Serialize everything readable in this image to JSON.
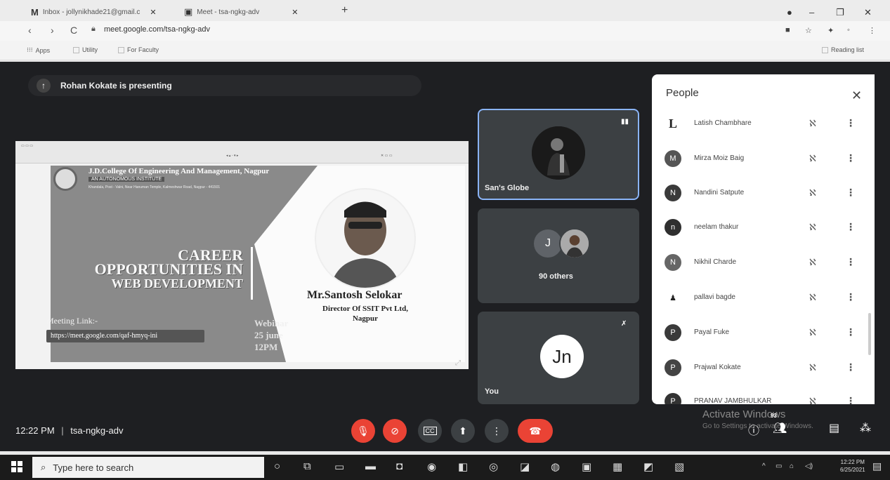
{
  "browser": {
    "tabs": [
      {
        "icon": "M",
        "title": "Inbox - jollynikhade21@gmail.c",
        "close": "✕"
      },
      {
        "icon": "▣",
        "title": "Meet - tsa-ngkg-adv",
        "close": "✕"
      }
    ],
    "new_tab": "+",
    "url": "meet.google.com/tsa-ngkg-adv",
    "bookmarks": [
      "Apps",
      "Utility",
      "For Faculty"
    ],
    "reading_list": "Reading list"
  },
  "meet": {
    "presenting_banner": "Rohan Kokate is presenting",
    "slide": {
      "college_name": "J.D.College Of Engineering And Management, Nagpur",
      "autonomous": "AN AUTONOMOUS INSTITUTE",
      "address": "Khandala, Post - Valni, Near Hanuman Temple, Kalmeshwar Road, Nagpur - 441501",
      "title_line1": "CAREER",
      "title_line2": "OPPORTUNITIES IN",
      "title_line3": "WEB DEVELOPMENT",
      "speaker_name": "Mr.Santosh Selokar",
      "speaker_role": "Director Of SSIT Pvt Ltd, Nagpur",
      "meeting_link_label": "Meeting Link:-",
      "meeting_link": "https://meet.google.com/qaf-hmyq-ini",
      "webinar": "Webinar",
      "webinar_date": "25 june",
      "webinar_time": "12PM"
    },
    "tiles": [
      {
        "label": "San's Globe"
      },
      {
        "label": "90 others",
        "initial": "J"
      },
      {
        "label": "You",
        "initial": "Jn"
      }
    ],
    "people_panel": {
      "title": "People",
      "people": [
        {
          "name": "Latish Chambhare",
          "initial": "L",
          "color": "#444444"
        },
        {
          "name": "Mirza Moiz Baig",
          "initial": "M",
          "color": "#555555"
        },
        {
          "name": "Nandini Satpute",
          "initial": "N",
          "color": "#3a3a3a"
        },
        {
          "name": "neelam thakur",
          "initial": "n",
          "color": "#2f2f2f"
        },
        {
          "name": "Nikhil Charde",
          "initial": "N",
          "color": "#666666"
        },
        {
          "name": "pallavi bagde",
          "initial": "p",
          "color": "#555555"
        },
        {
          "name": "Payal Fuke",
          "initial": "P",
          "color": "#3a3a3a"
        },
        {
          "name": "Prajwal Kokate",
          "initial": "P",
          "color": "#444444"
        },
        {
          "name": "PRANAV JAMBHULKAR",
          "initial": "P",
          "color": "#333333"
        }
      ]
    },
    "bottom": {
      "time": "12:22 PM",
      "separator": "|",
      "meeting_code": "tsa-ngkg-adv",
      "participant_count": "93"
    },
    "watermark": {
      "line1": "Activate Windows",
      "line2": "Go to Settings to activate Windows."
    }
  },
  "taskbar": {
    "search_placeholder": "Type here to search",
    "time": "12:22 PM",
    "date": "6/25/2021"
  }
}
